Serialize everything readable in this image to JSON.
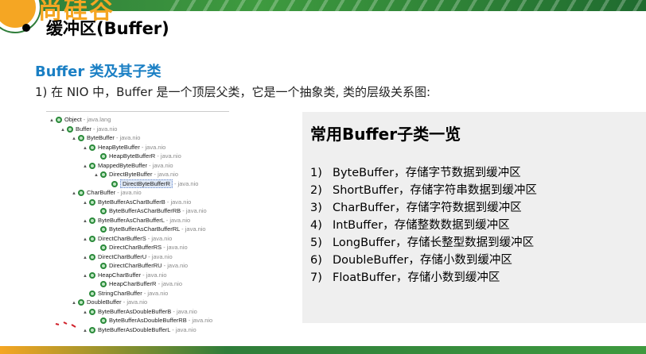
{
  "slide": {
    "heading": "缓冲区(Buffer)",
    "subheading": "Buffer 类及其子类",
    "intro": "1) 在 NIO 中，Buffer 是一个顶层父类，它是一个抽象类, 类的层级关系图:"
  },
  "tree": [
    {
      "indent": 0,
      "arrow": "▲",
      "name": "Object",
      "pkg": " - java.lang"
    },
    {
      "indent": 1,
      "arrow": "▲",
      "name": "Buffer",
      "pkg": " - java.nio"
    },
    {
      "indent": 2,
      "arrow": "▲",
      "name": "ByteBuffer",
      "pkg": " - java.nio"
    },
    {
      "indent": 3,
      "arrow": "▲",
      "name": "HeapByteBuffer",
      "pkg": " - java.nio"
    },
    {
      "indent": 4,
      "arrow": "",
      "name": "HeapByteBufferR",
      "pkg": " - java.nio"
    },
    {
      "indent": 3,
      "arrow": "▲",
      "name": "MappedByteBuffer",
      "pkg": " - java.nio"
    },
    {
      "indent": 4,
      "arrow": "▲",
      "name": "DirectByteBuffer",
      "pkg": " - java.nio"
    },
    {
      "indent": 5,
      "arrow": "",
      "name": "DirectByteBufferR",
      "pkg": " - java.nio",
      "selected": true
    },
    {
      "indent": 2,
      "arrow": "▲",
      "name": "CharBuffer",
      "pkg": " - java.nio"
    },
    {
      "indent": 3,
      "arrow": "▲",
      "name": "ByteBufferAsCharBufferB",
      "pkg": " - java.nio"
    },
    {
      "indent": 4,
      "arrow": "",
      "name": "ByteBufferAsCharBufferRB",
      "pkg": " - java.nio"
    },
    {
      "indent": 3,
      "arrow": "▲",
      "name": "ByteBufferAsCharBufferL",
      "pkg": " - java.nio"
    },
    {
      "indent": 4,
      "arrow": "",
      "name": "ByteBufferAsCharBufferRL",
      "pkg": " - java.nio"
    },
    {
      "indent": 3,
      "arrow": "▲",
      "name": "DirectCharBufferS",
      "pkg": " - java.nio"
    },
    {
      "indent": 4,
      "arrow": "",
      "name": "DirectCharBufferRS",
      "pkg": " - java.nio"
    },
    {
      "indent": 3,
      "arrow": "▲",
      "name": "DirectCharBufferU",
      "pkg": " - java.nio"
    },
    {
      "indent": 4,
      "arrow": "",
      "name": "DirectCharBufferRU",
      "pkg": " - java.nio"
    },
    {
      "indent": 3,
      "arrow": "▲",
      "name": "HeapCharBuffer",
      "pkg": " - java.nio"
    },
    {
      "indent": 4,
      "arrow": "",
      "name": "HeapCharBufferR",
      "pkg": " - java.nio"
    },
    {
      "indent": 3,
      "arrow": "",
      "name": "StringCharBuffer",
      "pkg": " - java.nio"
    },
    {
      "indent": 2,
      "arrow": "▲",
      "name": "DoubleBuffer",
      "pkg": " - java.nio"
    },
    {
      "indent": 3,
      "arrow": "▲",
      "name": "ByteBufferAsDoubleBufferB",
      "pkg": " - java.nio"
    },
    {
      "indent": 4,
      "arrow": "",
      "name": "ByteBufferAsDoubleBufferRB",
      "pkg": " - java.nio"
    },
    {
      "indent": 3,
      "arrow": "▲",
      "name": "ByteBufferAsDoubleBufferL",
      "pkg": " - java.nio"
    }
  ],
  "panel": {
    "title": "常用Buffer子类一览",
    "items": [
      {
        "num": "1)",
        "text": "ByteBuffer，存储字节数据到缓冲区"
      },
      {
        "num": "2)",
        "text": "ShortBuffer，存储字符串数据到缓冲区"
      },
      {
        "num": "3)",
        "text": "CharBuffer，存储字符数据到缓冲区"
      },
      {
        "num": "4)",
        "text": "IntBuffer，存储整数数据到缓冲区"
      },
      {
        "num": "5)",
        "text": "LongBuffer，存储长整型数据到缓冲区"
      },
      {
        "num": "6)",
        "text": "DoubleBuffer，存储小数到缓冲区"
      },
      {
        "num": "7)",
        "text": "FloatBuffer，存储小数到缓冲区"
      }
    ]
  },
  "colors": {
    "brand_green": "#2f7d3a",
    "brand_orange": "#f5a623",
    "subheading_blue": "#1a7fc4",
    "panel_bg": "#efefef"
  },
  "icons": [
    "class-icon",
    "expand-arrow-icon"
  ]
}
